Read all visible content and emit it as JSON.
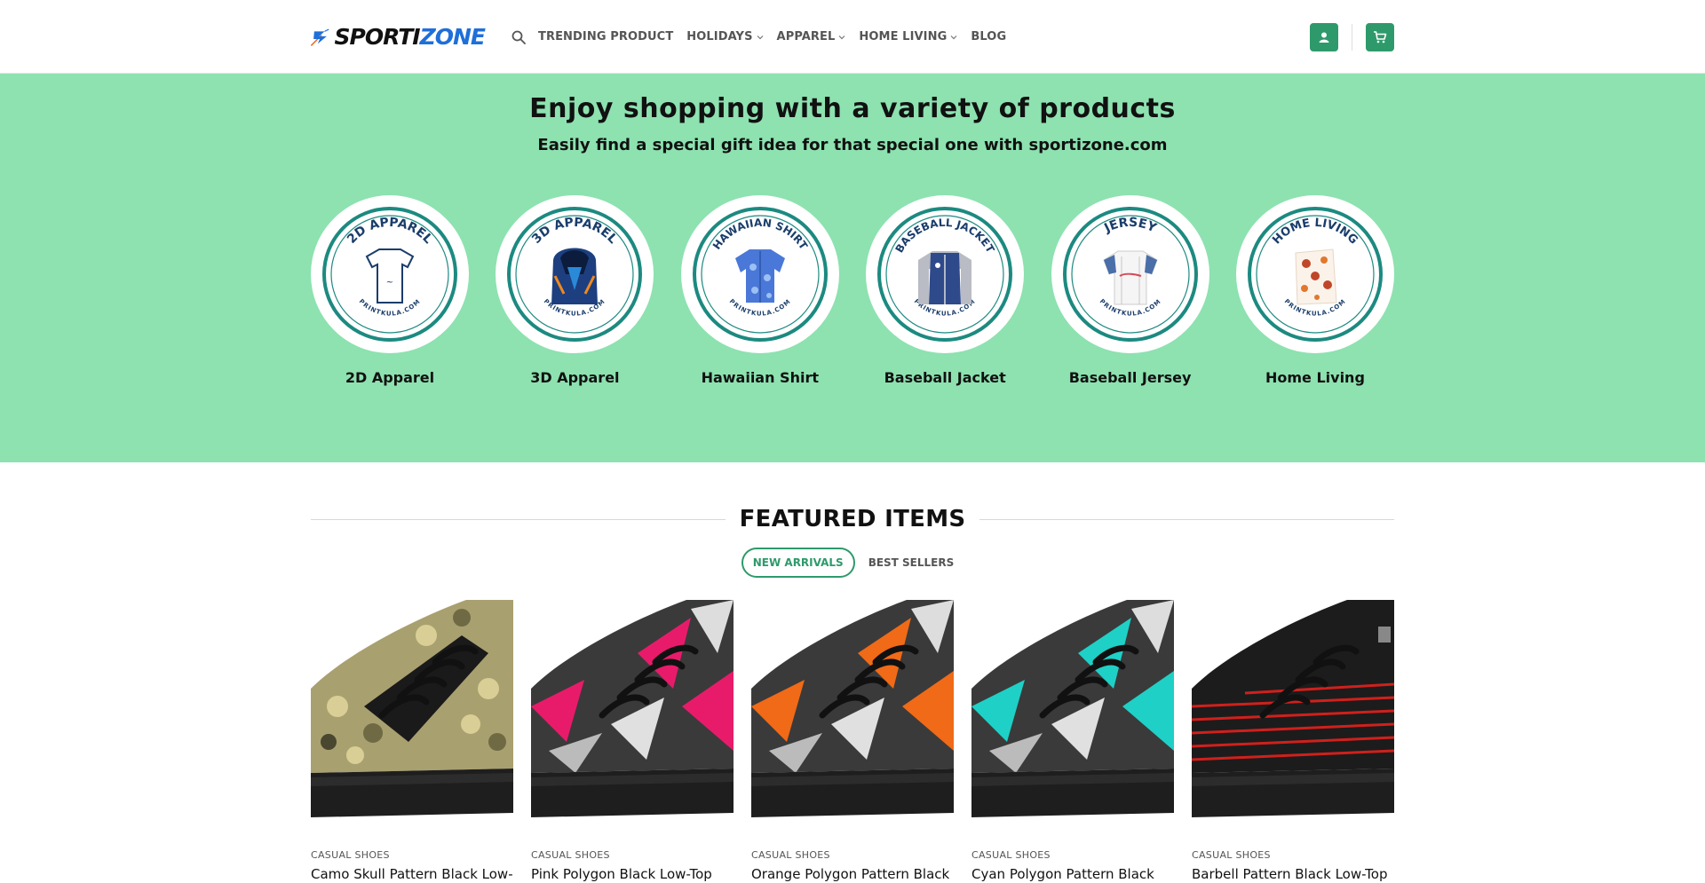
{
  "header": {
    "logo": {
      "part1": "SPORTI",
      "part2": "ZONE"
    },
    "nav": [
      {
        "label": "TRENDING PRODUCT",
        "dropdown": false
      },
      {
        "label": "HOLIDAYS",
        "dropdown": true
      },
      {
        "label": "APPAREL",
        "dropdown": true
      },
      {
        "label": "HOME LIVING",
        "dropdown": true
      },
      {
        "label": "BLOG",
        "dropdown": false
      }
    ],
    "icons": {
      "search": "search-icon",
      "account": "user-icon",
      "cart": "cart-icon"
    },
    "accent_color": "#2e9a6b"
  },
  "hero": {
    "title": "Enjoy shopping with a variety of products",
    "subtitle": "Easily find a special gift idea for that special one with sportizone.com",
    "background": "#8de2b0",
    "categories": [
      {
        "badge": "2D APPAREL",
        "site": "PRINTKULA.COM",
        "label": "2D Apparel",
        "art": "tshirt"
      },
      {
        "badge": "3D APPAREL",
        "site": "PRINTKULA.COM",
        "label": "3D Apparel",
        "art": "hoodie"
      },
      {
        "badge": "HAWAIIAN SHIRT",
        "site": "PRINTKULA.COM",
        "label": "Hawaiian Shirt",
        "art": "hawaiian"
      },
      {
        "badge": "BASEBALL JACKET",
        "site": "PRINTKULA.COM",
        "label": "Baseball Jacket",
        "art": "jacket"
      },
      {
        "badge": "JERSEY",
        "site": "PRINTKULA.COM",
        "label": "Baseball Jersey",
        "art": "jersey"
      },
      {
        "badge": "HOME LIVING",
        "site": "PRINTKULA.COM",
        "label": "Home Living",
        "art": "blanket"
      }
    ]
  },
  "featured": {
    "title": "FEATURED ITEMS",
    "tabs": [
      {
        "label": "NEW ARRIVALS",
        "active": true
      },
      {
        "label": "BEST SELLERS",
        "active": false
      }
    ],
    "products": [
      {
        "category": "CASUAL SHOES",
        "name": "Camo Skull Pattern Black Low-",
        "pattern": "camo"
      },
      {
        "category": "CASUAL SHOES",
        "name": "Pink Polygon Black Low-Top",
        "pattern": "#e81b6b"
      },
      {
        "category": "CASUAL SHOES",
        "name": "Orange Polygon Pattern Black",
        "pattern": "#f06a17"
      },
      {
        "category": "CASUAL SHOES",
        "name": "Cyan Polygon Pattern Black",
        "pattern": "#1fd0c6"
      },
      {
        "category": "CASUAL SHOES",
        "name": "Barbell Pattern Black Low-Top",
        "pattern": "barbell"
      }
    ]
  }
}
